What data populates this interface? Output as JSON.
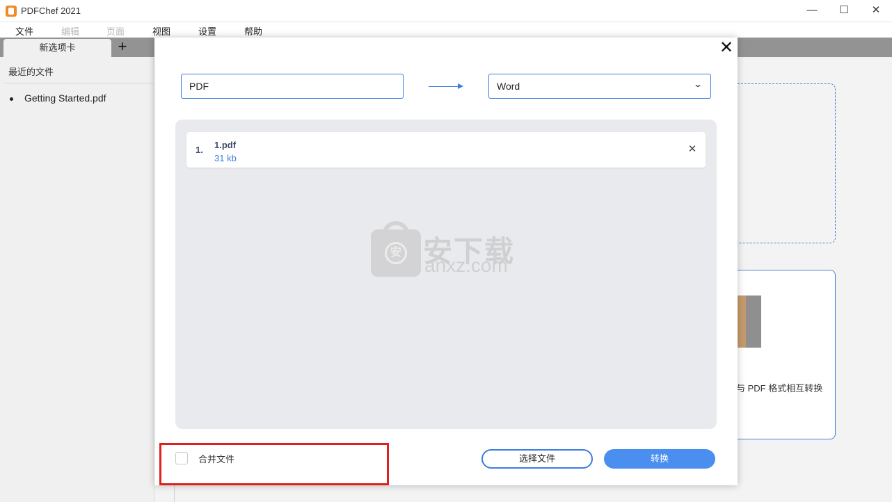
{
  "window": {
    "title": "PDFChef 2021",
    "minimize_glyph": "—",
    "maximize_glyph": "☐",
    "close_glyph": "✕"
  },
  "menu": {
    "file": "文件",
    "edit": "编辑",
    "page": "页面",
    "view": "视图",
    "settings": "设置",
    "help": "帮助"
  },
  "tabs": {
    "active_label": "新选项卡",
    "add_glyph": "+"
  },
  "sidebar": {
    "recent_title": "最近的文件",
    "recent_files": [
      "Getting Started.pdf"
    ]
  },
  "background": {
    "card_text": "与 PDF 格式相互转换"
  },
  "dialog": {
    "close_glyph": "✕",
    "source_format": "PDF",
    "target_format": "Word",
    "files": [
      {
        "index": "1.",
        "name": "1.pdf",
        "size": "31 kb"
      }
    ],
    "remove_glyph": "✕",
    "merge_label": "合并文件",
    "merge_checked": false,
    "choose_button": "选择文件",
    "convert_button": "转换"
  },
  "watermark": {
    "logo_char": "安",
    "cn_text": "安下载",
    "en_text": "anxz.com"
  },
  "colors": {
    "accent": "#3b7ddd",
    "primary_button": "#4a8ff0",
    "highlight_box": "#e0201c",
    "file_area": "#e9eaed"
  }
}
